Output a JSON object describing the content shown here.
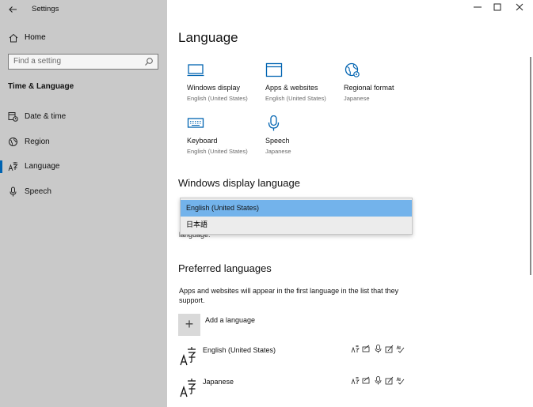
{
  "app": {
    "title": "Settings"
  },
  "sidebar": {
    "home": "Home",
    "search_placeholder": "Find a setting",
    "section": "Time & Language",
    "items": [
      {
        "label": "Date & time",
        "icon": "calendar-clock-icon"
      },
      {
        "label": "Region",
        "icon": "globe-icon"
      },
      {
        "label": "Language",
        "icon": "language-icon",
        "selected": true
      },
      {
        "label": "Speech",
        "icon": "microphone-icon"
      }
    ]
  },
  "main": {
    "title": "Language",
    "tiles": [
      {
        "title": "Windows display",
        "subtitle": "English (United States)",
        "icon": "monitor-icon"
      },
      {
        "title": "Apps & websites",
        "subtitle": "English (United States)",
        "icon": "browser-window-icon"
      },
      {
        "title": "Regional format",
        "subtitle": "Japanese",
        "icon": "globe-settings-icon"
      },
      {
        "title": "Keyboard",
        "subtitle": "English (United States)",
        "icon": "keyboard-icon"
      },
      {
        "title": "Speech",
        "subtitle": "Japanese",
        "icon": "microphone-icon"
      }
    ],
    "display_language": {
      "heading": "Windows display language",
      "options": [
        "English (United States)",
        "日本語"
      ],
      "selected_index": 0,
      "trailing_text": "language."
    },
    "preferred": {
      "heading": "Preferred languages",
      "description": "Apps and websites will appear in the first language in the list that they support.",
      "add_label": "Add a language",
      "languages": [
        {
          "name": "English (United States)"
        },
        {
          "name": "Japanese"
        }
      ]
    }
  },
  "colors": {
    "accent": "#0063b1",
    "sidebar_bg": "#c9c9c9",
    "dropdown_selected": "#73b3eb"
  }
}
